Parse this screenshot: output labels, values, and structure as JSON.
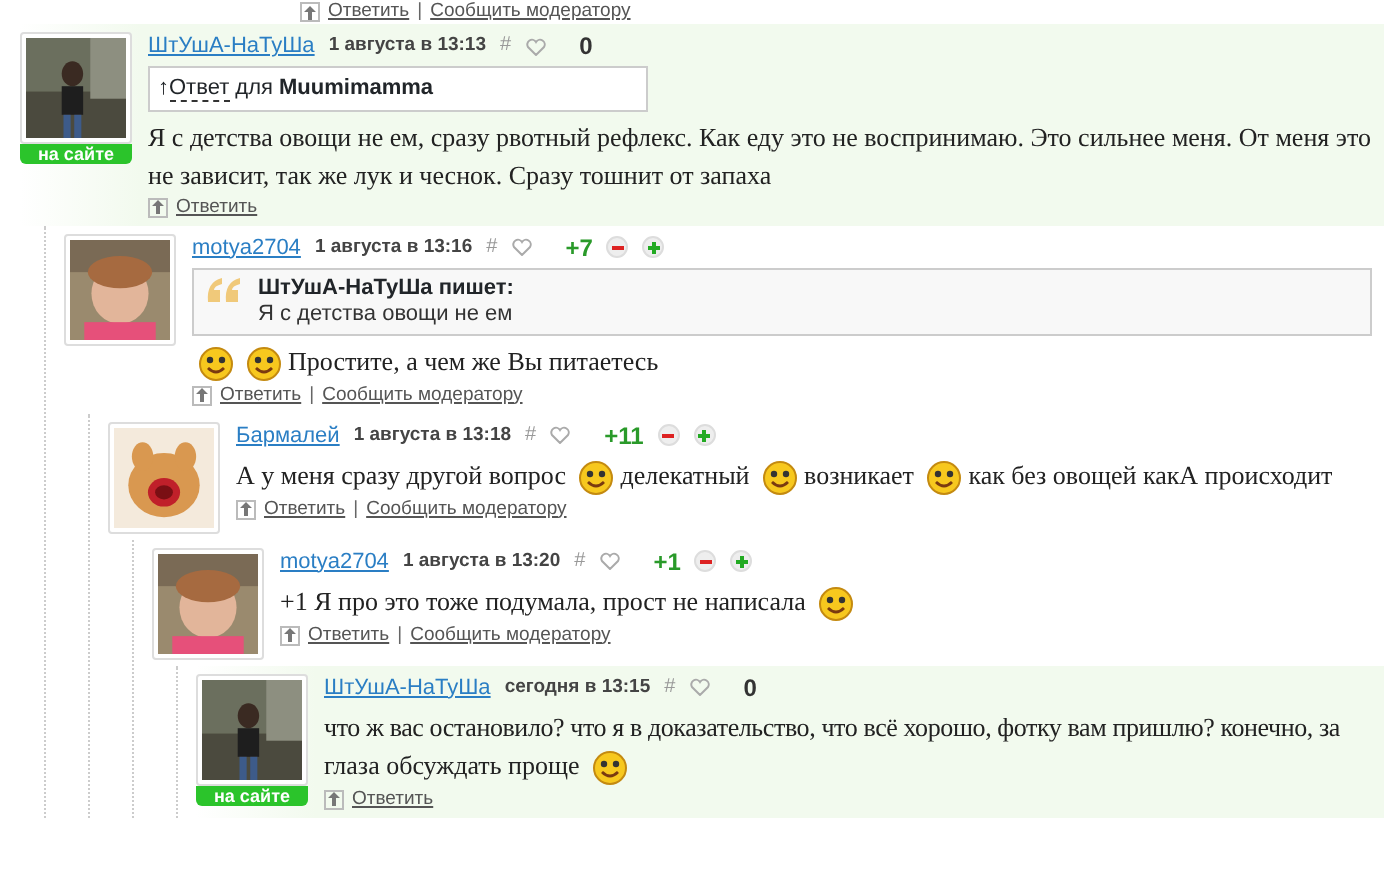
{
  "top_actions": {
    "reply": "Ответить",
    "separator": "|",
    "report": "Сообщить модератору"
  },
  "comments": [
    {
      "author": "ШтУшА-НаТуШа",
      "date": "1 августа в 13:13",
      "hash": "#",
      "score": "0",
      "votable": false,
      "online": "на сайте",
      "highlighted": true,
      "reply_to": {
        "arrow": "↑",
        "label": "Ответ",
        "prefix": "для",
        "name": "Muumimamma"
      },
      "body": [
        {
          "kind": "text",
          "text": "Я с детства овощи не ем, сразу рвотный рефлекс. Как еду это не воспринимаю. Это сильнее меня. От меня это не зависит, так же лук и чеснок. Сразу тошнит от запаха"
        }
      ],
      "actions": {
        "reply": "Ответить"
      },
      "children": [
        {
          "author": "motya2704",
          "date": "1 августа в 13:16",
          "hash": "#",
          "score": "+7",
          "votable": true,
          "highlighted": false,
          "quote": {
            "title": "ШтУшА-НаТуШа пишет:",
            "text": "Я с детства овощи не ем"
          },
          "body": [
            {
              "kind": "smiley"
            },
            {
              "kind": "smiley"
            },
            {
              "kind": "text",
              "text": "Простите, а чем же Вы питаетесь"
            }
          ],
          "actions": {
            "reply": "Ответить",
            "separator": "|",
            "report": "Сообщить модератору"
          },
          "children": [
            {
              "author": "Бармалей",
              "date": "1 августа в 13:18",
              "hash": "#",
              "score": "+11",
              "votable": true,
              "highlighted": false,
              "body": [
                {
                  "kind": "text",
                  "text": "А у меня сразу другой вопрос"
                },
                {
                  "kind": "smiley"
                },
                {
                  "kind": "text",
                  "text": "делекатный"
                },
                {
                  "kind": "smiley"
                },
                {
                  "kind": "text",
                  "text": "возникает"
                },
                {
                  "kind": "smiley"
                },
                {
                  "kind": "text",
                  "text": "как без овощей какА происходит"
                }
              ],
              "actions": {
                "reply": "Ответить",
                "separator": "|",
                "report": "Сообщить модератору"
              },
              "children": [
                {
                  "author": "motya2704",
                  "date": "1 августа в 13:20",
                  "hash": "#",
                  "score": "+1",
                  "votable": true,
                  "highlighted": false,
                  "body": [
                    {
                      "kind": "text",
                      "text": "+1 Я про это тоже подумала, прост не написала"
                    },
                    {
                      "kind": "smiley"
                    }
                  ],
                  "actions": {
                    "reply": "Ответить",
                    "separator": "|",
                    "report": "Сообщить модератору"
                  },
                  "children": [
                    {
                      "author": "ШтУшА-НаТуШа",
                      "date": "сегодня в 13:15",
                      "hash": "#",
                      "score": "0",
                      "votable": false,
                      "online": "на сайте",
                      "highlighted": true,
                      "body": [
                        {
                          "kind": "line",
                          "text": "что ж вас остановило? что я в доказательство, что всё хорошо, фотку вам пришлю? конечно, за"
                        },
                        {
                          "kind": "text",
                          "text": "глаза обсуждать проще"
                        },
                        {
                          "kind": "smiley"
                        }
                      ],
                      "actions": {
                        "reply": "Ответить"
                      }
                    }
                  ]
                }
              ]
            }
          ]
        }
      ]
    }
  ]
}
